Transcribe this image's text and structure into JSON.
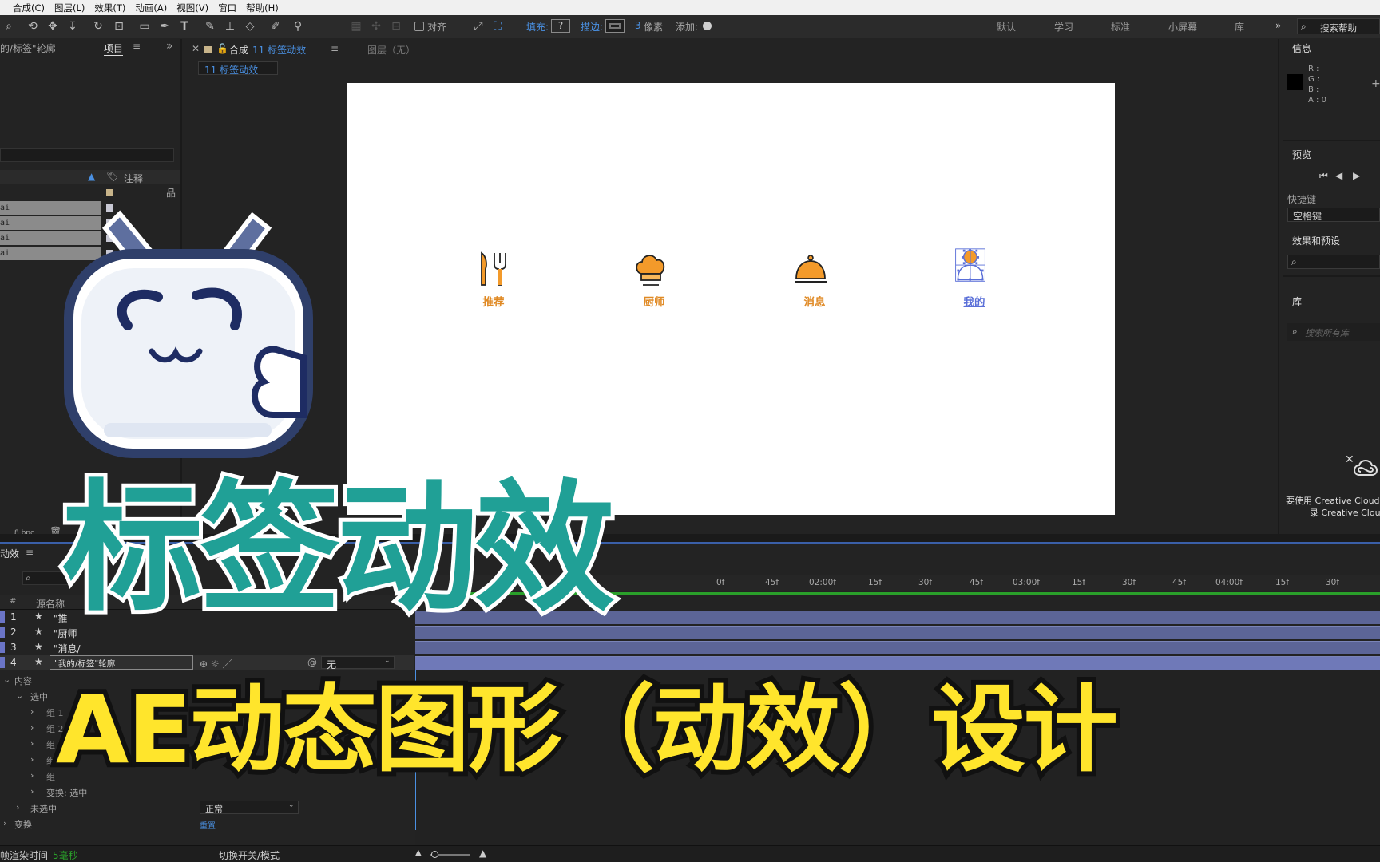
{
  "menu": [
    "合成(C)",
    "图层(L)",
    "效果(T)",
    "动画(A)",
    "视图(V)",
    "窗口",
    "帮助(H)"
  ],
  "toolbar": {
    "align_label": "对齐",
    "fill_label": "填充:",
    "fill_value": "?",
    "stroke_label": "描边:",
    "stroke_width": "3",
    "stroke_unit": "像素",
    "add_label": "添加:",
    "workspaces": [
      "默认",
      "学习",
      "标准",
      "小屏幕",
      "库"
    ],
    "search_help": "搜索帮助"
  },
  "project": {
    "breadcrumb": "的/标签\"轮廓",
    "tab_label": "项目",
    "col_label": "注释",
    "rows": [
      "ai",
      "ai",
      "ai",
      "ai"
    ],
    "bpc": "8 bpc"
  },
  "composition": {
    "tab_prefix": "合成",
    "tab_name": "11 标签动效",
    "layer_tab": "图层（无）",
    "subtab": "11 标签动效"
  },
  "canvas": {
    "tabs": [
      {
        "label": "推荐",
        "icon": "fork-knife-icon",
        "selected": false
      },
      {
        "label": "厨师",
        "icon": "chef-hat-icon",
        "selected": false
      },
      {
        "label": "消息",
        "icon": "cloche-icon",
        "selected": false
      },
      {
        "label": "我的",
        "icon": "person-icon",
        "selected": true
      }
    ],
    "accent": "#e08a25",
    "selected_color": "#5a6fd8"
  },
  "info_panel": {
    "title": "信息",
    "r": "R :",
    "g": "G :",
    "b": "B :",
    "a": "A : 0",
    "preview_title": "预览",
    "shortcut_title": "快捷键",
    "shortcut_value": "空格键",
    "effects_title": "效果和预设",
    "library_title": "库",
    "library_search": "搜索所有库",
    "cc_line1": "要使用 Creative Cloud",
    "cc_line2": "录 Creative Clou"
  },
  "timeline": {
    "comp_tab": "动效",
    "col_num": "#",
    "col_source": "源名称",
    "ruler": [
      "0f",
      "45f",
      "02:00f",
      "15f",
      "30f",
      "45f",
      "03:00f",
      "15f",
      "30f",
      "45f",
      "04:00f",
      "15f",
      "30f"
    ],
    "layers": [
      {
        "num": "1",
        "name": "\"推"
      },
      {
        "num": "2",
        "name": "\"厨师"
      },
      {
        "num": "3",
        "name": "\"消息/"
      },
      {
        "num": "4",
        "name": "\"我的/标签\"轮廓"
      }
    ],
    "layer4_mode": "无",
    "props": {
      "content": "内容",
      "selected": "选中",
      "groups": [
        "组 1",
        "组 2",
        "组 3",
        "组",
        "组"
      ],
      "transform_selected": "变换: 选中",
      "unselected": "未选中",
      "transform": "变换",
      "blend_mode": "正常",
      "reset": "重置"
    },
    "render_time_label": "帧渲染时间",
    "render_time_value": "5毫秒",
    "toggle_label": "切换开关/模式"
  },
  "overlay": {
    "title": "标签动效",
    "subtitle": "AE动态图形（动效）设计"
  }
}
